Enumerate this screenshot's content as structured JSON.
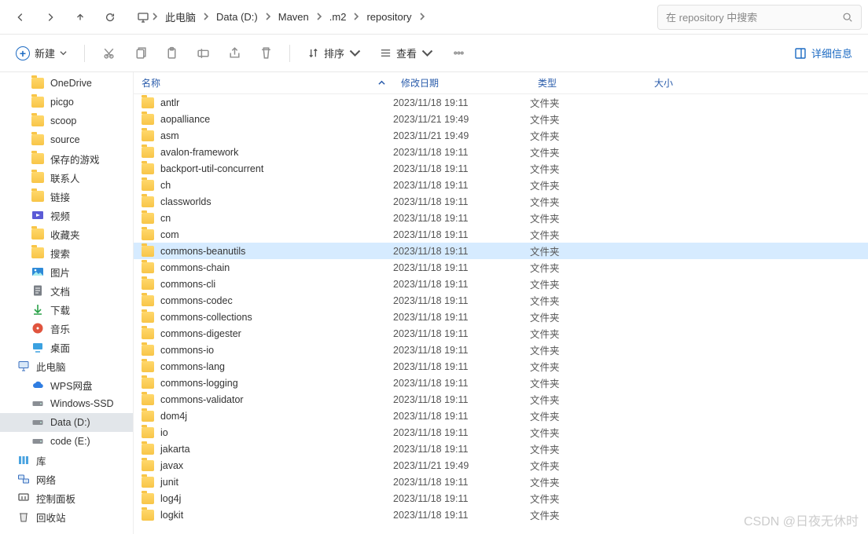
{
  "breadcrumbs": [
    "此电脑",
    "Data (D:)",
    "Maven",
    ".m2",
    "repository"
  ],
  "search_placeholder": "在 repository 中搜索",
  "toolbar": {
    "new": "新建",
    "sort": "排序",
    "view": "查看",
    "details": "详细信息"
  },
  "columns": {
    "name": "名称",
    "date": "修改日期",
    "type": "类型",
    "size": "大小"
  },
  "sidebar": [
    {
      "kind": "folder",
      "label": "OneDrive",
      "lv": 2
    },
    {
      "kind": "folder",
      "label": "picgo",
      "lv": 2
    },
    {
      "kind": "folder",
      "label": "scoop",
      "lv": 2
    },
    {
      "kind": "folder",
      "label": "source",
      "lv": 2
    },
    {
      "kind": "folder",
      "label": "保存的游戏",
      "lv": 2
    },
    {
      "kind": "folder",
      "label": "联系人",
      "lv": 2
    },
    {
      "kind": "folder",
      "label": "链接",
      "lv": 2
    },
    {
      "kind": "video",
      "label": "视频",
      "lv": 2
    },
    {
      "kind": "folder",
      "label": "收藏夹",
      "lv": 2
    },
    {
      "kind": "folder",
      "label": "搜索",
      "lv": 2
    },
    {
      "kind": "pic",
      "label": "图片",
      "lv": 2
    },
    {
      "kind": "doc",
      "label": "文档",
      "lv": 2
    },
    {
      "kind": "down",
      "label": "下载",
      "lv": 2
    },
    {
      "kind": "music",
      "label": "音乐",
      "lv": 2
    },
    {
      "kind": "desk",
      "label": "桌面",
      "lv": 2
    },
    {
      "kind": "pc",
      "label": "此电脑",
      "lv": 1
    },
    {
      "kind": "cloud",
      "label": "WPS网盘",
      "lv": 2
    },
    {
      "kind": "disk",
      "label": "Windows-SSD",
      "lv": 2
    },
    {
      "kind": "disk",
      "label": "Data (D:)",
      "lv": 2,
      "sel": true
    },
    {
      "kind": "disk",
      "label": "code (E:)",
      "lv": 2
    },
    {
      "kind": "lib",
      "label": "库",
      "lv": 1
    },
    {
      "kind": "net",
      "label": "网络",
      "lv": 1
    },
    {
      "kind": "ctrl",
      "label": "控制面板",
      "lv": 1
    },
    {
      "kind": "bin",
      "label": "回收站",
      "lv": 1
    }
  ],
  "rows": [
    {
      "name": "antlr",
      "date": "2023/11/18 19:11",
      "type": "文件夹"
    },
    {
      "name": "aopalliance",
      "date": "2023/11/21 19:49",
      "type": "文件夹"
    },
    {
      "name": "asm",
      "date": "2023/11/21 19:49",
      "type": "文件夹"
    },
    {
      "name": "avalon-framework",
      "date": "2023/11/18 19:11",
      "type": "文件夹"
    },
    {
      "name": "backport-util-concurrent",
      "date": "2023/11/18 19:11",
      "type": "文件夹"
    },
    {
      "name": "ch",
      "date": "2023/11/18 19:11",
      "type": "文件夹"
    },
    {
      "name": "classworlds",
      "date": "2023/11/18 19:11",
      "type": "文件夹"
    },
    {
      "name": "cn",
      "date": "2023/11/18 19:11",
      "type": "文件夹"
    },
    {
      "name": "com",
      "date": "2023/11/18 19:11",
      "type": "文件夹"
    },
    {
      "name": "commons-beanutils",
      "date": "2023/11/18 19:11",
      "type": "文件夹",
      "sel": true
    },
    {
      "name": "commons-chain",
      "date": "2023/11/18 19:11",
      "type": "文件夹"
    },
    {
      "name": "commons-cli",
      "date": "2023/11/18 19:11",
      "type": "文件夹"
    },
    {
      "name": "commons-codec",
      "date": "2023/11/18 19:11",
      "type": "文件夹"
    },
    {
      "name": "commons-collections",
      "date": "2023/11/18 19:11",
      "type": "文件夹"
    },
    {
      "name": "commons-digester",
      "date": "2023/11/18 19:11",
      "type": "文件夹"
    },
    {
      "name": "commons-io",
      "date": "2023/11/18 19:11",
      "type": "文件夹"
    },
    {
      "name": "commons-lang",
      "date": "2023/11/18 19:11",
      "type": "文件夹"
    },
    {
      "name": "commons-logging",
      "date": "2023/11/18 19:11",
      "type": "文件夹"
    },
    {
      "name": "commons-validator",
      "date": "2023/11/18 19:11",
      "type": "文件夹"
    },
    {
      "name": "dom4j",
      "date": "2023/11/18 19:11",
      "type": "文件夹"
    },
    {
      "name": "io",
      "date": "2023/11/18 19:11",
      "type": "文件夹"
    },
    {
      "name": "jakarta",
      "date": "2023/11/18 19:11",
      "type": "文件夹"
    },
    {
      "name": "javax",
      "date": "2023/11/21 19:49",
      "type": "文件夹"
    },
    {
      "name": "junit",
      "date": "2023/11/18 19:11",
      "type": "文件夹"
    },
    {
      "name": "log4j",
      "date": "2023/11/18 19:11",
      "type": "文件夹"
    },
    {
      "name": "logkit",
      "date": "2023/11/18 19:11",
      "type": "文件夹"
    }
  ],
  "watermark": "CSDN @日夜无休时"
}
